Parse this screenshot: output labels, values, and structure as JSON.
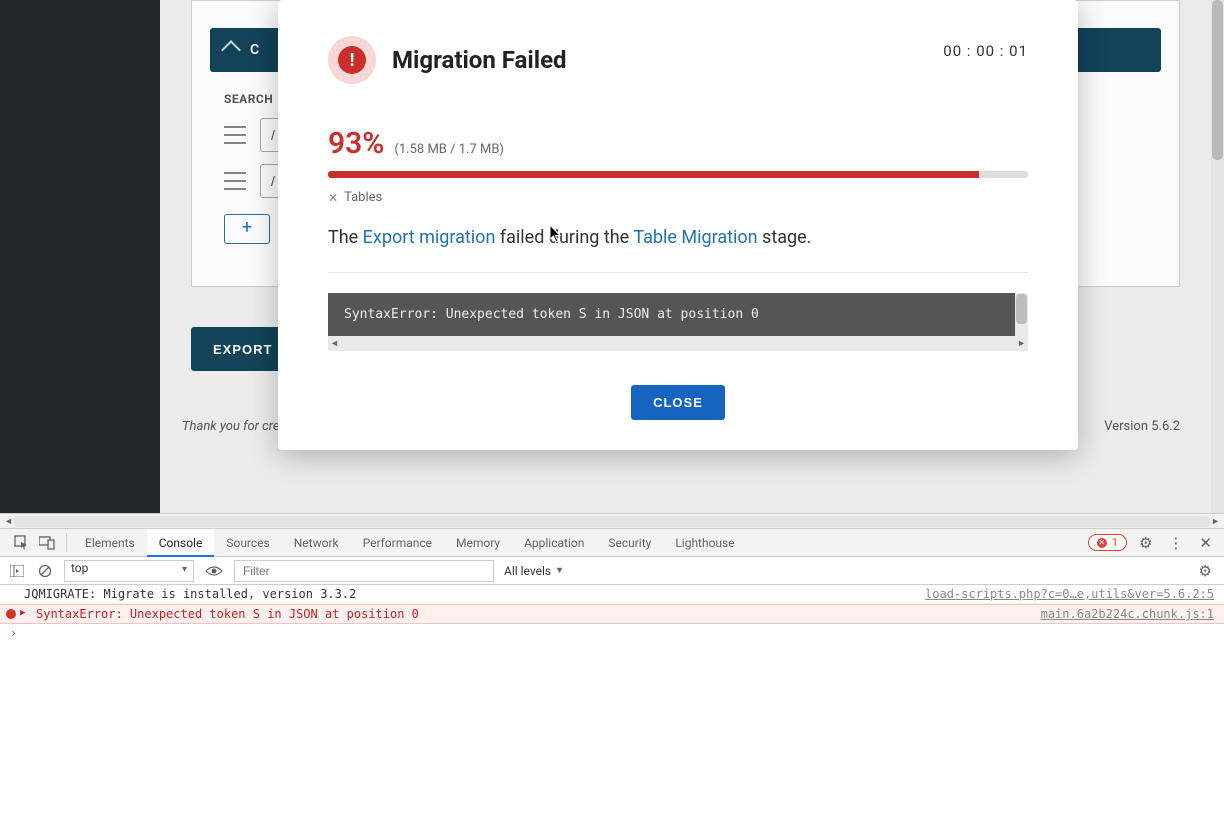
{
  "page": {
    "banner_label": "C",
    "search_label": "SEARCH",
    "rule_prefix": "/",
    "add_label": "+",
    "export_label": "EXPORT",
    "footer_thanks": "Thank you for cre",
    "version": "Version 5.6.2"
  },
  "modal": {
    "title": "Migration Failed",
    "timer": "00 : 00 : 01",
    "percent": "93%",
    "progress_pct": 93,
    "size": "(1.58 MB / 1.7 MB)",
    "stage_label": "Tables",
    "message_pre": "The ",
    "message_link1": "Export migration",
    "message_mid": " failed during the ",
    "message_link2": "Table Migration",
    "message_post": " stage.",
    "error_text": "SyntaxError: Unexpected token S in JSON at position 0",
    "close_label": "CLOSE"
  },
  "devtools": {
    "tabs": [
      "Elements",
      "Console",
      "Sources",
      "Network",
      "Performance",
      "Memory",
      "Application",
      "Security",
      "Lighthouse"
    ],
    "active_tab": "Console",
    "error_count": "1",
    "context": "top",
    "filter_placeholder": "Filter",
    "levels_label": "All levels",
    "logs": [
      {
        "type": "log",
        "text": "JQMIGRATE: Migrate is installed, version 3.3.2",
        "source": "load-scripts.php?c=0…e,utils&ver=5.6.2:5"
      },
      {
        "type": "err",
        "text": "SyntaxError: Unexpected token S in JSON at position 0",
        "source": "main.6a2b224c.chunk.js:1"
      }
    ]
  }
}
